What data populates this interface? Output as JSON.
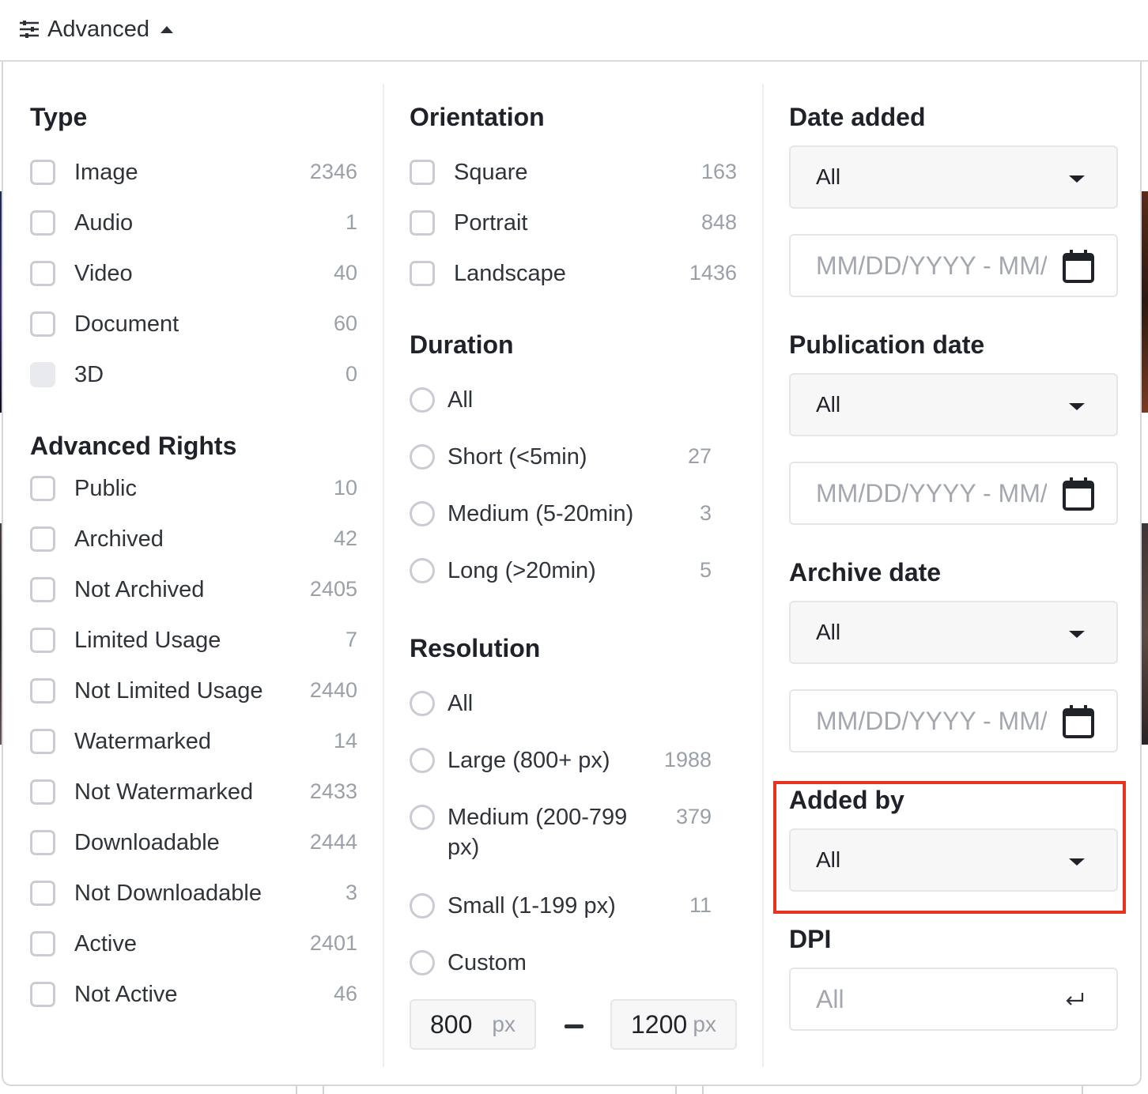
{
  "toolbar": {
    "advanced_label": "Advanced"
  },
  "type": {
    "title": "Type",
    "items": [
      {
        "label": "Image",
        "count": "2346"
      },
      {
        "label": "Audio",
        "count": "1"
      },
      {
        "label": "Video",
        "count": "40"
      },
      {
        "label": "Document",
        "count": "60"
      },
      {
        "label": "3D",
        "count": "0"
      }
    ]
  },
  "rights": {
    "title": "Advanced Rights",
    "items": [
      {
        "label": "Public",
        "count": "10"
      },
      {
        "label": "Archived",
        "count": "42"
      },
      {
        "label": "Not Archived",
        "count": "2405"
      },
      {
        "label": "Limited Usage",
        "count": "7"
      },
      {
        "label": "Not Limited Usage",
        "count": "2440"
      },
      {
        "label": "Watermarked",
        "count": "14"
      },
      {
        "label": "Not Watermarked",
        "count": "2433"
      },
      {
        "label": "Downloadable",
        "count": "2444"
      },
      {
        "label": "Not Downloadable",
        "count": "3"
      },
      {
        "label": "Active",
        "count": "2401"
      },
      {
        "label": "Not Active",
        "count": "46"
      }
    ]
  },
  "orientation": {
    "title": "Orientation",
    "items": [
      {
        "label": "Square",
        "count": "163"
      },
      {
        "label": "Portrait",
        "count": "848"
      },
      {
        "label": "Landscape",
        "count": "1436"
      }
    ]
  },
  "duration": {
    "title": "Duration",
    "items": [
      {
        "label": "All",
        "count": ""
      },
      {
        "label": "Short (<5min)",
        "count": "27"
      },
      {
        "label": "Medium (5-20min)",
        "count": "3"
      },
      {
        "label": "Long (>20min)",
        "count": "5"
      }
    ]
  },
  "resolution": {
    "title": "Resolution",
    "items": [
      {
        "label": "All",
        "count": ""
      },
      {
        "label": "Large (800+ px)",
        "count": "1988"
      },
      {
        "label": "Medium (200-799",
        "label2": "px)",
        "count": "379"
      },
      {
        "label": "Small (1-199 px)",
        "count": "11"
      },
      {
        "label": "Custom",
        "count": ""
      }
    ],
    "min_value": "800",
    "max_value": "1200",
    "unit": "px"
  },
  "date_added": {
    "title": "Date added",
    "select": "All",
    "placeholder": "MM/DD/YYYY - MM/DD/YYYY"
  },
  "publication_date": {
    "title": "Publication date",
    "select": "All",
    "placeholder": "MM/DD/YYYY - MM/DD/YYYY"
  },
  "archive_date": {
    "title": "Archive date",
    "select": "All",
    "placeholder": "MM/DD/YYYY - MM/DD/YYYY"
  },
  "added_by": {
    "title": "Added by",
    "select": "All"
  },
  "dpi": {
    "title": "DPI",
    "placeholder": "All"
  },
  "colors": {
    "highlight": "#e8341c",
    "checkbox_border": "#c9cdd3",
    "count_text": "#9aa0a8"
  }
}
